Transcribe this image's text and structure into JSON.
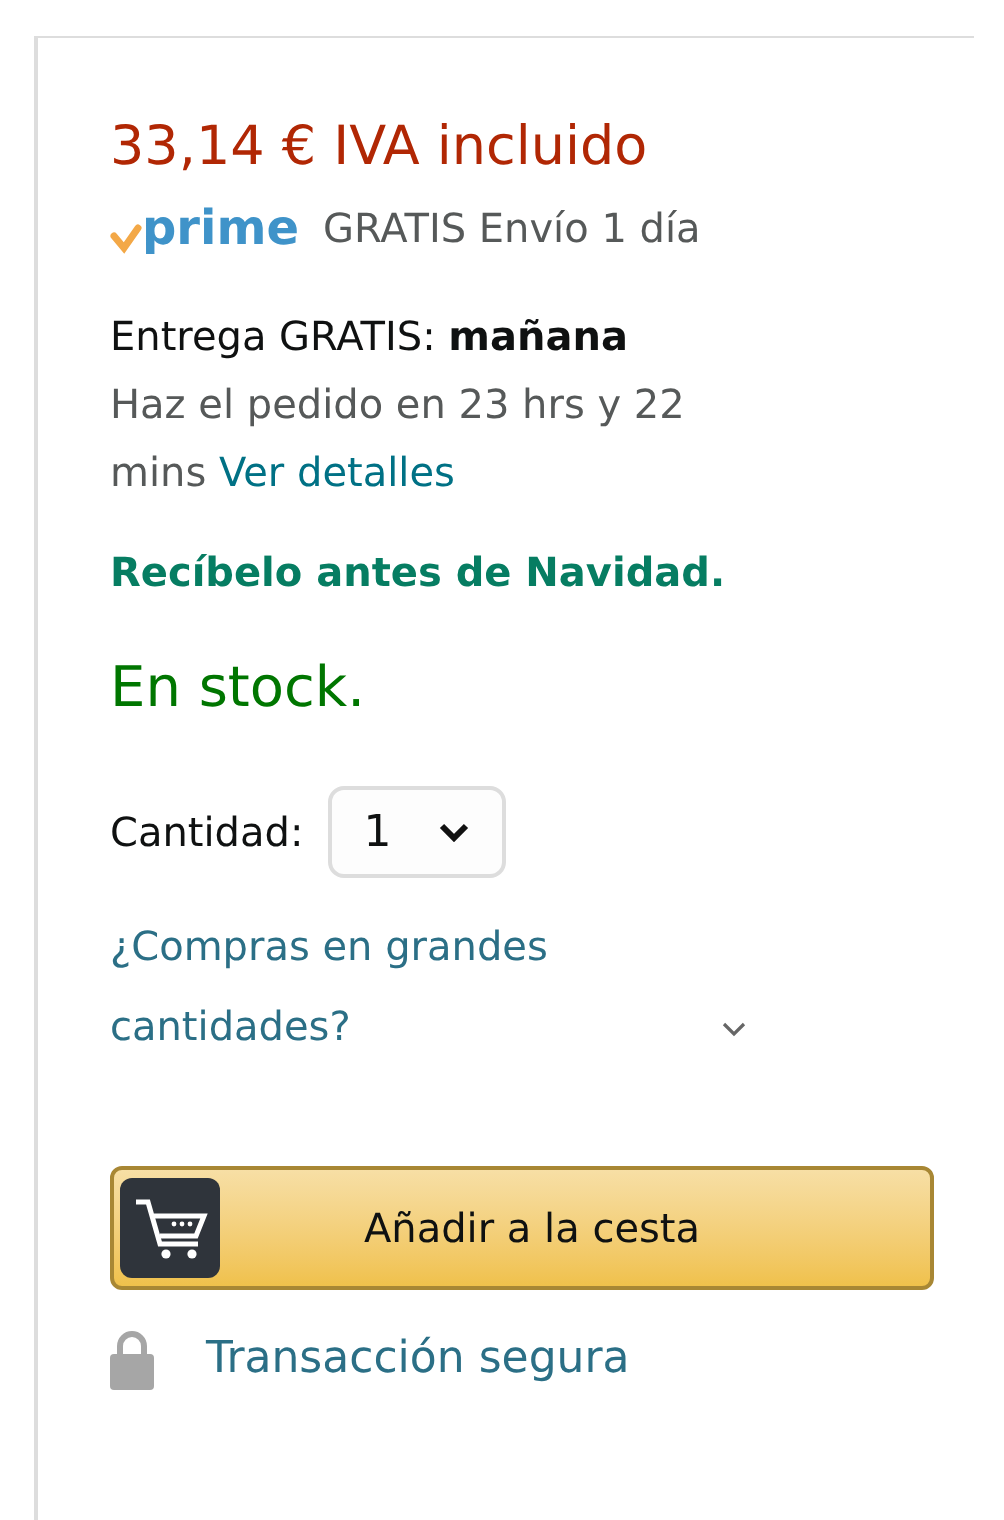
{
  "price": "33,14 € IVA incluido",
  "prime": {
    "logo": "prime",
    "shipping": "GRATIS Envío 1 día"
  },
  "delivery": {
    "line": "Entrega GRATIS: **mañana**",
    "countdown": "Haz el pedido en 23 hrs y 22 mins",
    "link": "Ver detalles"
  },
  "christmas_note": "Recíbelo antes de Navidad.",
  "availability": "En stock.",
  "quantity": {
    "label": "Cantidad:",
    "value": "1"
  },
  "bulk_link": "¿Compras en grandes cantidades?",
  "add_to_cart": "Añadir a la cesta",
  "secure": "Transacción segura"
}
